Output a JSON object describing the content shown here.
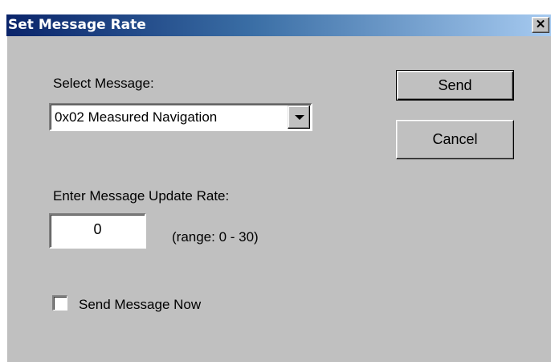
{
  "window": {
    "title": "Set Message Rate",
    "close_glyph": "✕"
  },
  "message_select": {
    "label": "Select Message:",
    "selected_value": "0x02 Measured Navigation"
  },
  "buttons": {
    "send": "Send",
    "cancel": "Cancel"
  },
  "rate": {
    "label": "Enter Message Update Rate:",
    "value": "0",
    "range_hint": "(range: 0 - 30)"
  },
  "send_now": {
    "label": "Send Message Now",
    "checked": false
  },
  "colors": {
    "dialog_bg": "#c0c0c0",
    "titlebar_start": "#0a246a",
    "titlebar_end": "#a6caf0"
  }
}
